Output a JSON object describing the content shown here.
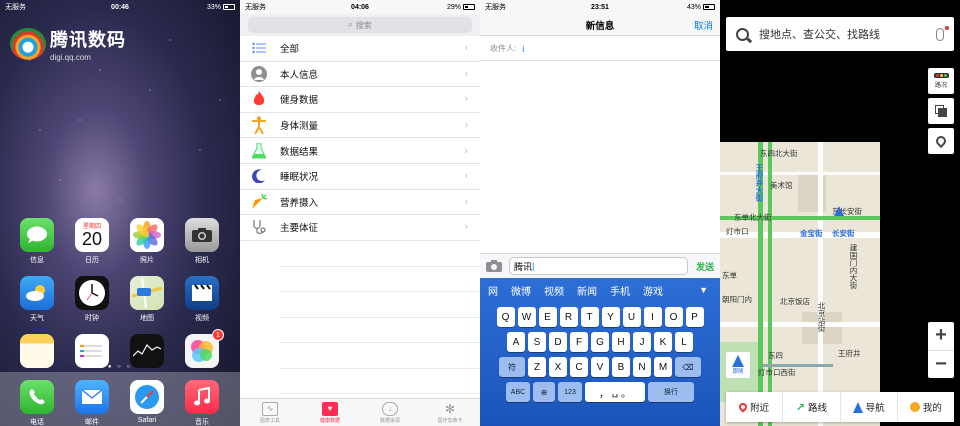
{
  "home": {
    "status": {
      "carrier": "无服务",
      "time": "00:46",
      "battery": "33%"
    },
    "logo": {
      "title": "腾讯数码",
      "subtitle": "digi.qq.com"
    },
    "calendar": {
      "weekday": "星期四",
      "day": "20"
    },
    "apps": [
      {
        "name": "信息",
        "icon": "messages-icon"
      },
      {
        "name": "日历",
        "icon": "calendar-icon"
      },
      {
        "name": "照片",
        "icon": "photos-icon"
      },
      {
        "name": "相机",
        "icon": "camera-icon"
      },
      {
        "name": "天气",
        "icon": "weather-icon"
      },
      {
        "name": "时钟",
        "icon": "clock-icon"
      },
      {
        "name": "地图",
        "icon": "maps-icon"
      },
      {
        "name": "视频",
        "icon": "videos-icon"
      },
      {
        "name": "",
        "icon": "notes-icon"
      },
      {
        "name": "",
        "icon": "reminders-icon"
      },
      {
        "name": "",
        "icon": "stocks-icon"
      },
      {
        "name": "",
        "icon": "game-center-icon",
        "badge": "1"
      }
    ],
    "dock": [
      {
        "name": "电话",
        "icon": "phone-icon"
      },
      {
        "name": "邮件",
        "icon": "mail-icon"
      },
      {
        "name": "Safari",
        "icon": "safari-icon"
      },
      {
        "name": "音乐",
        "icon": "music-icon"
      }
    ]
  },
  "health": {
    "status": {
      "carrier": "无服务",
      "time": "04:06",
      "battery": "29%"
    },
    "search_placeholder": "搜索",
    "categories": [
      {
        "label": "全部",
        "icon": "list-icon",
        "color": "#5a8dee"
      },
      {
        "label": "本人信息",
        "icon": "person-icon",
        "color": "#8e8e93"
      },
      {
        "label": "健身数据",
        "icon": "flame-icon",
        "color": "#ff3b30"
      },
      {
        "label": "身体测量",
        "icon": "body-icon",
        "color": "#f5a623"
      },
      {
        "label": "数据结果",
        "icon": "flask-icon",
        "color": "#4cd964"
      },
      {
        "label": "睡眠状况",
        "icon": "moon-icon",
        "color": "#3a4bb8"
      },
      {
        "label": "营养摄入",
        "icon": "carrot-icon",
        "color": "#ff9500"
      },
      {
        "label": "主要体征",
        "icon": "stethoscope-icon",
        "color": "#8e8e93"
      }
    ],
    "tabs": [
      {
        "label": "图表工具",
        "active": false
      },
      {
        "label": "健康数据",
        "active": true
      },
      {
        "label": "数据来源",
        "active": false
      },
      {
        "label": "医疗急救卡",
        "active": false
      }
    ]
  },
  "message": {
    "status": {
      "carrier": "无服务",
      "time": "23:51",
      "battery": "43%"
    },
    "title": "新信息",
    "cancel": "取消",
    "to_label": "收件人:",
    "input_value": "腾讯",
    "send": "发送",
    "candidates": [
      "网",
      "微博",
      "视频",
      "新闻",
      "手机",
      "游戏"
    ],
    "rows": [
      [
        "Q",
        "W",
        "E",
        "R",
        "T",
        "Y",
        "U",
        "I",
        "O",
        "P"
      ],
      [
        "A",
        "S",
        "D",
        "F",
        "G",
        "H",
        "J",
        "K",
        "L"
      ],
      [
        "Z",
        "X",
        "C",
        "V",
        "B",
        "N",
        "M"
      ]
    ],
    "special": {
      "shift": "符",
      "abc": "ABC",
      "num": "123",
      "return": "换行",
      "comma": "，",
      "period": "。"
    }
  },
  "map": {
    "search_placeholder": "搜地点、查公交、找路线",
    "traffic": "路况",
    "labels": [
      "北京站",
      "东直门",
      "北滨河路",
      "灯市口",
      "王府井",
      "东单",
      "东四",
      "建国门",
      "朝阳门"
    ],
    "map_texts": {
      "a": "东四北大街",
      "b": "美术馆",
      "c": "王府井大街",
      "d": "东单北大街",
      "e": "灯市口",
      "f": "金宝街",
      "g": "长安街",
      "h": "东长安街",
      "i": "建国门内大街",
      "j": "北京站街",
      "k": "东四",
      "l": "灯市口西街",
      "m": "王府井",
      "n": "东单",
      "o": "北京饭店",
      "p": "朝阳门内"
    },
    "bottom": [
      {
        "label": "附近",
        "icon": "nearby-pin-icon"
      },
      {
        "label": "路线",
        "icon": "route-icon"
      },
      {
        "label": "导航",
        "icon": "navigate-icon"
      },
      {
        "label": "我的",
        "icon": "profile-icon"
      }
    ],
    "locate_label": "跟随",
    "zoom_in": "+",
    "zoom_out": "−"
  }
}
